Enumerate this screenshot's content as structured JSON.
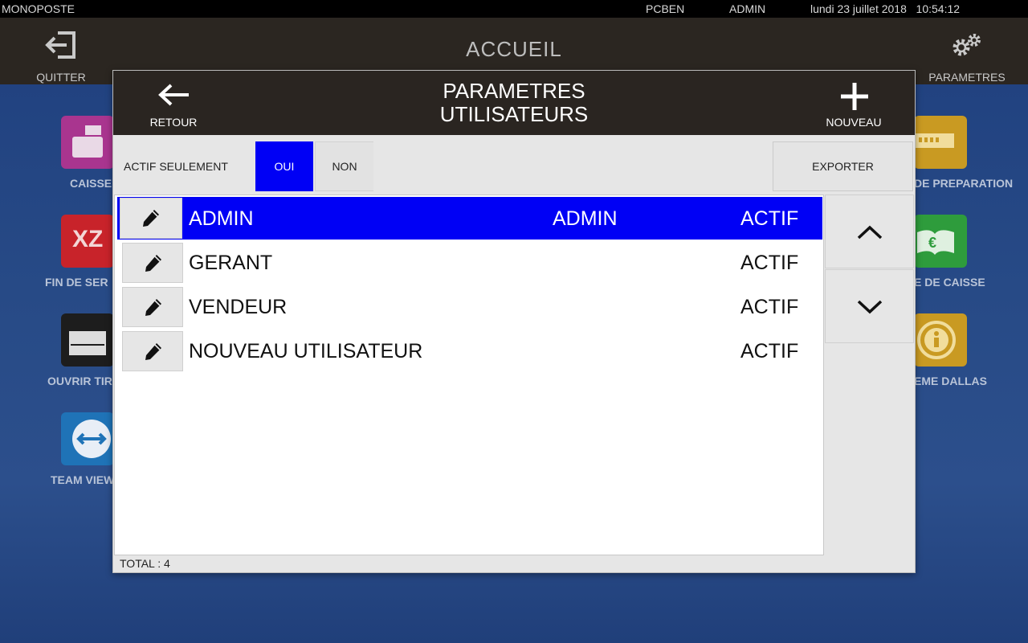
{
  "statusbar": {
    "app_name": "MONOPOSTE",
    "computer": "PCBEN",
    "user": "ADMIN",
    "datetime": "lundi 23 juillet 2018   10:54:12"
  },
  "header": {
    "title": "ACCUEIL",
    "quit_label": "QUITTER",
    "params_label": "PARAMETRES"
  },
  "tiles": {
    "left": [
      {
        "label": "CAISSE",
        "icon": "cash-register-icon",
        "color": "#a9358f"
      },
      {
        "label": "FIN DE SER",
        "icon": "xz-icon",
        "color": "#c8232a"
      },
      {
        "label": "OUVRIR TIR",
        "icon": "drawer-icon",
        "color": "#1d1d1d"
      },
      {
        "label": "TEAM VIEW",
        "icon": "teamviewer-icon",
        "color": "#1f73b7"
      }
    ],
    "right": [
      {
        "label": "DE PREPARATION",
        "icon": "printer-icon",
        "color": "#c99a22"
      },
      {
        "label": "E DE CAISSE",
        "icon": "euro-book-icon",
        "color": "#2e9c3c"
      },
      {
        "label": "EME DALLAS",
        "icon": "info-icon",
        "color": "#c99a22"
      }
    ]
  },
  "modal": {
    "title_line1": "PARAMETRES",
    "title_line2": "UTILISATEURS",
    "back_label": "RETOUR",
    "new_label": "NOUVEAU",
    "filter_label": "ACTIF SEULEMENT",
    "toggle_yes": "OUI",
    "toggle_no": "NON",
    "export_label": "EXPORTER",
    "total": "TOTAL : 4",
    "accent": "#0000f5",
    "users": [
      {
        "name": "ADMIN",
        "role": "ADMIN",
        "status": "ACTIF",
        "selected": true
      },
      {
        "name": "GERANT",
        "role": "",
        "status": "ACTIF",
        "selected": false
      },
      {
        "name": "VENDEUR",
        "role": "",
        "status": "ACTIF",
        "selected": false
      },
      {
        "name": "NOUVEAU UTILISATEUR",
        "role": "",
        "status": "ACTIF",
        "selected": false
      }
    ]
  }
}
